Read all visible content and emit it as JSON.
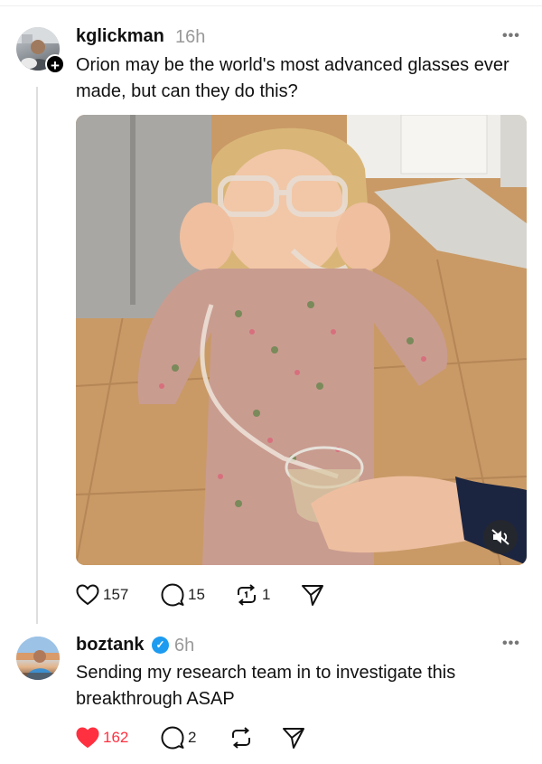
{
  "posts": [
    {
      "username": "kglickman",
      "time": "16h",
      "text": "Orion may be the world's most advanced glasses ever made, but can they do this?",
      "more_label": "•••",
      "follow_badge": "+",
      "actions": {
        "likes": "157",
        "replies": "15",
        "reposts": "1"
      },
      "liked": false,
      "has_video": true,
      "video_muted": true
    },
    {
      "username": "boztank",
      "verified": true,
      "verified_badge": "✓",
      "time": "6h",
      "text": "Sending my research team in to investigate this breakthrough ASAP",
      "more_label": "•••",
      "actions": {
        "likes": "162",
        "replies": "2",
        "reposts": ""
      },
      "liked": true
    }
  ],
  "colors": {
    "like_active": "#ff3040",
    "verified": "#1d9bf0",
    "muted_text": "#999999"
  },
  "icons": [
    "heart-icon",
    "reply-icon",
    "repost-icon",
    "share-icon",
    "mute-icon",
    "more-icon",
    "verified-icon",
    "plus-icon"
  ]
}
